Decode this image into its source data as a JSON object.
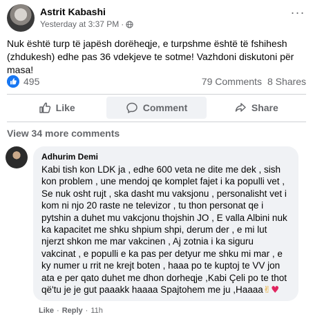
{
  "post": {
    "author": "Astrit Kabashi",
    "timestamp": "Yesterday at 3:37 PM",
    "separator": "·",
    "more_label": "···",
    "text": "Nuk është turp të japësh dorëheqje, e turpshme është të fshihesh (zhdukesh) edhe pas 36 vdekjeve te sotme! Vazhdoni diskutoni për masa!"
  },
  "stats": {
    "reactions": "495",
    "comments": "79 Comments",
    "shares": "8 Shares"
  },
  "actions": {
    "like": "Like",
    "comment": "Comment",
    "share": "Share"
  },
  "comments_section": {
    "view_more": "View 34 more comments"
  },
  "comment": {
    "author": "Adhurim Demi",
    "text": "Kabi tish kon LDK ja , edhe 600 veta ne dite me dek , sish kon problem , une mendoj qe komplet fajet i ka populli vet , Se nuk osht rujt , ska dasht mu vaksjonu , personalisht vet i kom ni njo 20 raste ne televizor , tu thon personat qe i pytshin a duhet mu vakcjonu thojshin JO , E valla Albini nuk ka kapacitet me shku shpium shpi, derum der , e mi lut njerzt shkon me mar vakcinen , Aj zotnia i ka siguru vakcinat , e populli e ka pas per detyur me shku mi mar , e ky numer u rrit ne krejt boten , haaa po te kuptoj te VV jon ata e per qato duhet me dhon dorheqje ,Kabi Çeli po te thot që'tu je je gut paaakk haaaa Spajtohem me ju ,Haaaa",
    "emoji_victory": "✌",
    "emoji_heart": "♥",
    "like_label": "Like",
    "reply_label": "Reply",
    "time": "11h",
    "dot": "·"
  },
  "colors": {
    "accent": "#1877f2",
    "secondary_text": "#65676b",
    "bubble_bg": "#f0f2f5"
  }
}
